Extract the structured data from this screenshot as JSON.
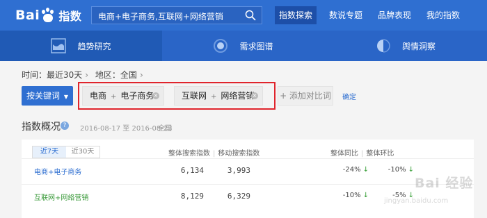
{
  "header": {
    "logo_text": "Bai du 指数",
    "search_query": "电商+电子商务,互联网+网络营销",
    "nav": [
      {
        "label": "指数探索",
        "active": true
      },
      {
        "label": "数说专题",
        "active": false
      },
      {
        "label": "品牌表现",
        "active": false
      },
      {
        "label": "我的指数",
        "active": false
      }
    ]
  },
  "subnav": {
    "tabs": [
      {
        "label": "趋势研究",
        "icon": "trend-chart-icon",
        "active": true
      },
      {
        "label": "需求图谱",
        "icon": "target-ring-icon",
        "active": false
      },
      {
        "label": "舆情洞察",
        "icon": "half-globe-icon",
        "active": false
      }
    ]
  },
  "filter": {
    "time": "时间：最近30天",
    "region": "地区：全国"
  },
  "keywords": {
    "button_label": "按关键词",
    "items": [
      {
        "parts": [
          "电商",
          "电子商务"
        ]
      },
      {
        "parts": [
          "互联网",
          "网络营销"
        ]
      }
    ],
    "add_compare": "+ 添加对比词",
    "confirm": "确定"
  },
  "overview": {
    "title": "指数概况",
    "date_range": "2016-08-17 至 2016-08-23",
    "region": "全国",
    "tabs": [
      "近7天",
      "近30天"
    ],
    "active_tab": 0,
    "headers": {
      "search_overall": "整体搜索指数",
      "search_mobile": "移动搜索指数",
      "yoy": "整体同比",
      "mom": "整体环比"
    },
    "rows": [
      {
        "name": "电商+电子商务",
        "overall": "6,134",
        "mobile": "3,993",
        "yoy": "-24%",
        "mom": "-10%"
      },
      {
        "name": "互联网+网络营销",
        "overall": "8,129",
        "mobile": "6,329",
        "yoy": "-10%",
        "mom": "-5%"
      }
    ]
  },
  "watermark": {
    "text": "Bai 经验",
    "sub": "jingyan.baidu.com"
  },
  "colors": {
    "brand_blue": "#2f6fd1",
    "highlight_red": "#e0242c",
    "down_green": "#2d9a2d"
  }
}
